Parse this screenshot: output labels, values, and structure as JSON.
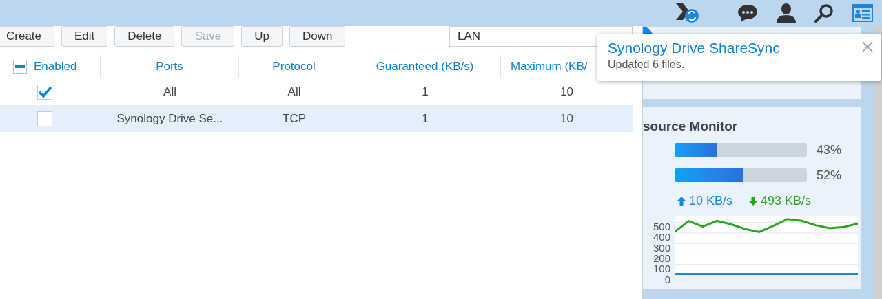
{
  "toolbar": {
    "buttons": [
      {
        "label": "Create",
        "disabled": false
      },
      {
        "label": "Edit",
        "disabled": false
      },
      {
        "label": "Delete",
        "disabled": false
      },
      {
        "label": "Save",
        "disabled": true
      },
      {
        "label": "Up",
        "disabled": false
      },
      {
        "label": "Down",
        "disabled": false
      }
    ],
    "dropdown": {
      "value": "LAN"
    }
  },
  "table": {
    "select_all": {
      "label": "Enabled",
      "partially_checked": true
    },
    "columns": [
      "Ports",
      "Protocol",
      "Guaranteed (KB/s)",
      "Maximum (KB/"
    ],
    "rows": [
      {
        "enabled": true,
        "selected": false,
        "cells": [
          "All",
          "All",
          "1",
          "10"
        ]
      },
      {
        "enabled": false,
        "selected": true,
        "cells": [
          "Synology Drive Se...",
          "TCP",
          "1",
          "10"
        ]
      }
    ]
  },
  "notification": {
    "title": "Synology Drive ShareSync",
    "message": "Updated 6 files."
  },
  "resource_monitor": {
    "title": "source Monitor",
    "meters": [
      {
        "level": 0.32,
        "reading": "43%"
      },
      {
        "level": 0.52,
        "reading": "52%"
      }
    ],
    "upload": "10 KB/s",
    "download": "493 KB/s",
    "chart_data": {
      "type": "line",
      "grid": true,
      "ylim": [
        0,
        550
      ],
      "yticks": [
        0,
        100,
        200,
        300,
        400,
        500
      ],
      "series": [
        {
          "color": "#2aa61e",
          "values": [
            410,
            513,
            460,
            515,
            483,
            438,
            410,
            467,
            532,
            516,
            474,
            445,
            456,
            489
          ]
        },
        {
          "color": "#1a86e0",
          "values": [
            10,
            10,
            10,
            10,
            10,
            10,
            10,
            10,
            10,
            10,
            10,
            10,
            10,
            10
          ]
        }
      ]
    }
  }
}
